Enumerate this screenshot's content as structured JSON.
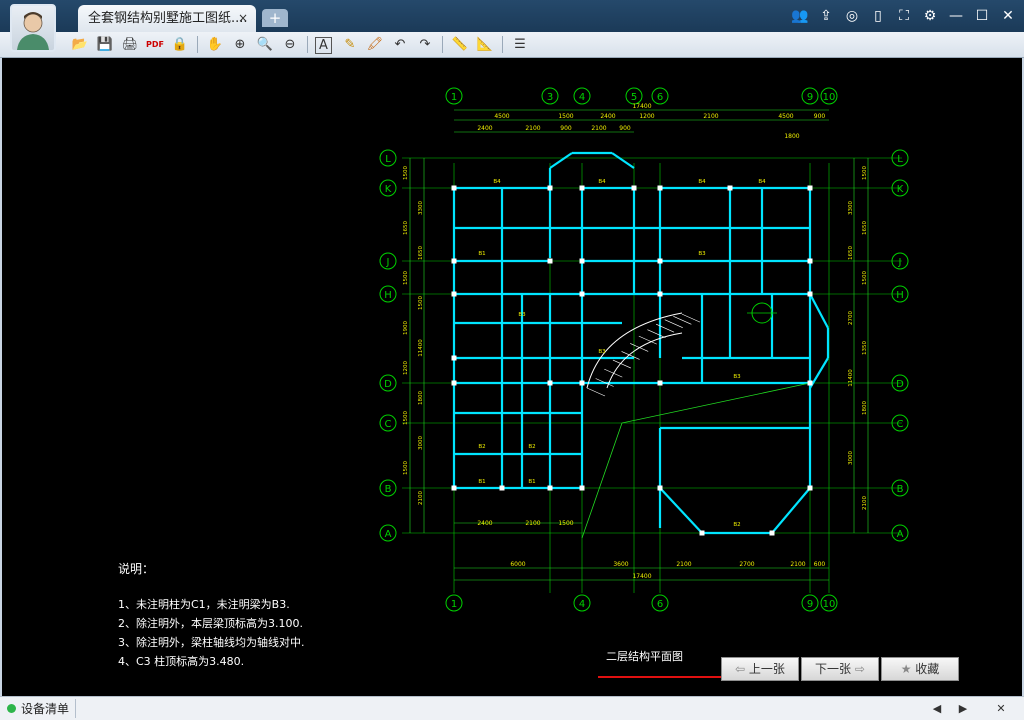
{
  "window": {
    "tab_title": "全套钢结构别墅施工图纸....",
    "tab_close": "×",
    "new_tab": "+",
    "buttons": {
      "users": "👥",
      "share": "⇪",
      "chat": "◎",
      "mobile": "▯",
      "fullscreen": "⛶",
      "settings": "⚙",
      "minimize": "—",
      "maximize": "☐",
      "close": "✕"
    }
  },
  "toolbar": {
    "open": "📂",
    "save": "💾",
    "print": "🖨",
    "pdf": "PDF",
    "lock": "🔒",
    "pan": "✋",
    "zoom_in": "⊕",
    "zoom": "🔍",
    "zoom_out": "⊖",
    "text": "A",
    "pen": "✎",
    "highlighter": "🖍",
    "undo": "↶",
    "redo": "↷",
    "measure": "📏",
    "measure2": "📐",
    "layers": "☰"
  },
  "drawing": {
    "axis_top": [
      "1",
      "3",
      "4",
      "5",
      "6",
      "9",
      "10"
    ],
    "axis_bottom": [
      "1",
      "4",
      "6",
      "9",
      "10"
    ],
    "axis_left": [
      "L",
      "K",
      "J",
      "H",
      "D",
      "C",
      "B",
      "A"
    ],
    "dims_top_total": "17400",
    "dims_top_row1": [
      "4500",
      "1500",
      "2400",
      "1200",
      "2100",
      "4500",
      "900"
    ],
    "dims_top_row2": [
      "2400",
      "2100",
      "900",
      "2100",
      "900"
    ],
    "dims_top_row3": [
      "1800"
    ],
    "dims_bottom_row1": [
      "2400",
      "2100",
      "1500"
    ],
    "dims_bottom_row2": [
      "6000",
      "3600",
      "2100",
      "2700",
      "2100",
      "600"
    ],
    "dims_bottom_total": "17400",
    "dims_left": [
      "1500",
      "3300",
      "1650",
      "1650",
      "1500",
      "1500",
      "1900",
      "11400",
      "1200",
      "1800",
      "1500",
      "3000",
      "1500",
      "2100"
    ],
    "dims_right": [
      "1500",
      "3300",
      "1650",
      "1650",
      "1500",
      "2700",
      "1350",
      "11400",
      "1800",
      "3000",
      "2100"
    ],
    "notes_title": "说明：",
    "notes": [
      "1、未注明柱为C1，未注明梁为B3.",
      "2、除注明外，本层梁顶标高为3.100.",
      "3、除注明外，梁柱轴线均为轴线对中.",
      "4、C3 柱顶标高为3.480."
    ],
    "drawing_title": "二层结构平面图"
  },
  "nav": {
    "prev": "上一张",
    "next": "下一张",
    "favorite": "收藏"
  },
  "status": {
    "label": "设备清单",
    "prev": "◀",
    "next": "▶",
    "close": "✕"
  },
  "colors": {
    "beam": "#00e5ff",
    "grid": "#00d000",
    "dim": "#22dd22",
    "text": "#f0f000",
    "column": "#ffffff",
    "red": "#e01010"
  }
}
